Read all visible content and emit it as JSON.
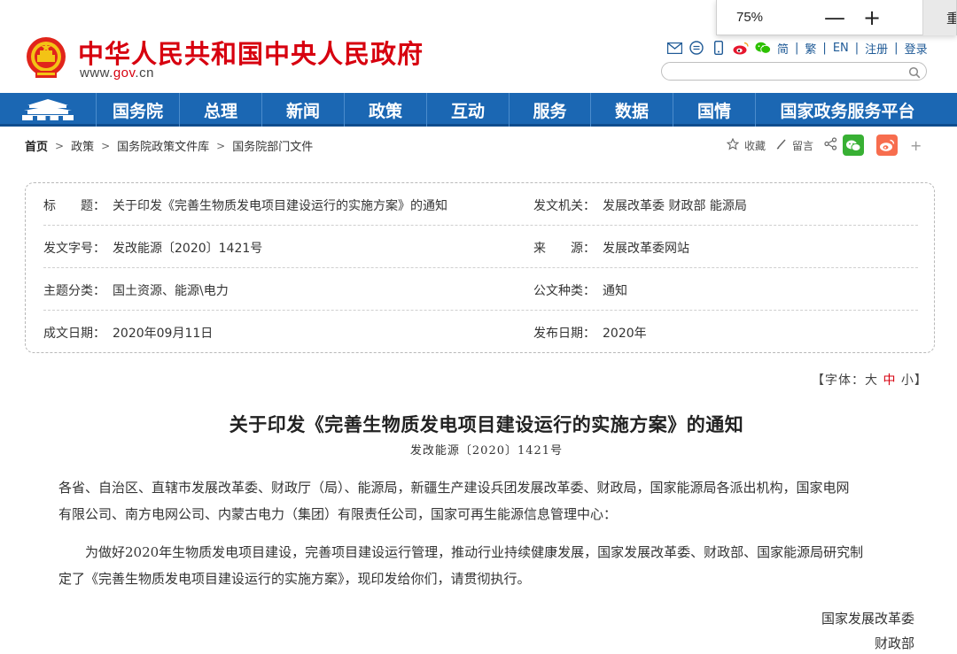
{
  "header": {
    "site_name": "中华人民共和国中央人民政府",
    "site_url_prefix": "www.",
    "site_url_domain": "gov",
    "site_url_suffix": ".cn",
    "links": [
      "简",
      "繁",
      "EN",
      "注册",
      "登录"
    ],
    "link_separator": "|",
    "icons": [
      "mail-icon",
      "chat-icon",
      "mobile-icon",
      "weibo-icon",
      "wechat-icon"
    ],
    "search_placeholder": ""
  },
  "zoom": {
    "value": "75%",
    "minus": "—",
    "plus": "+",
    "reset_label": "重置"
  },
  "nav": {
    "items": [
      "国务院",
      "总理",
      "新闻",
      "政策",
      "互动",
      "服务",
      "数据",
      "国情",
      "国家政务服务平台"
    ]
  },
  "breadcrumb": {
    "items": [
      "首页",
      "政策",
      "国务院政策文件库",
      "国务院部门文件"
    ],
    "arrow": ">"
  },
  "share": {
    "favorite": "收藏",
    "comment": "留言",
    "plus": "+"
  },
  "info": {
    "title_label": "标　　题：",
    "title_value": "关于印发《完善生物质发电项目建设运行的实施方案》的通知",
    "issuer_label": "发文机关：",
    "issuer_value": "发展改革委  财政部  能源局",
    "doc_no_label": "发文字号：",
    "doc_no_value": "发改能源〔2020〕1421号",
    "source_label": "来　　源：",
    "source_value": "发展改革委网站",
    "category_label": "主题分类：",
    "category_value": "国土资源、能源\\电力",
    "doc_type_label": "公文种类：",
    "doc_type_value": "通知",
    "written_date_label": "成文日期：",
    "written_date_value": "2020年09月11日",
    "publish_date_label": "发布日期：",
    "publish_date_value": "2020年"
  },
  "font_size": {
    "prefix": "【字体：",
    "large": "大",
    "medium": "中",
    "small": "小",
    "suffix": "】"
  },
  "article": {
    "title": "关于印发《完善生物质发电项目建设运行的实施方案》的通知",
    "doc_no": "发改能源〔2020〕1421号",
    "para1_line1": "各省、自治区、直辖市发展改革委、财政厅（局）、能源局，新疆生产建设兵团发展改革委、财政局，国家能源局各派出机构，国家电网",
    "para1_line2": "有限公司、南方电网公司、内蒙古电力（集团）有限责任公司，国家可再生能源信息管理中心：",
    "para2_line1": "为做好2020年生物质发电项目建设，完善项目建设运行管理，推动行业持续健康发展，国家发展改革委、财政部、国家能源局研究制",
    "para2_line2": "定了《完善生物质发电项目建设运行的实施方案》，现印发给你们，请贯彻执行。",
    "sign1": "国家发展改革委",
    "sign2": "财政部"
  }
}
